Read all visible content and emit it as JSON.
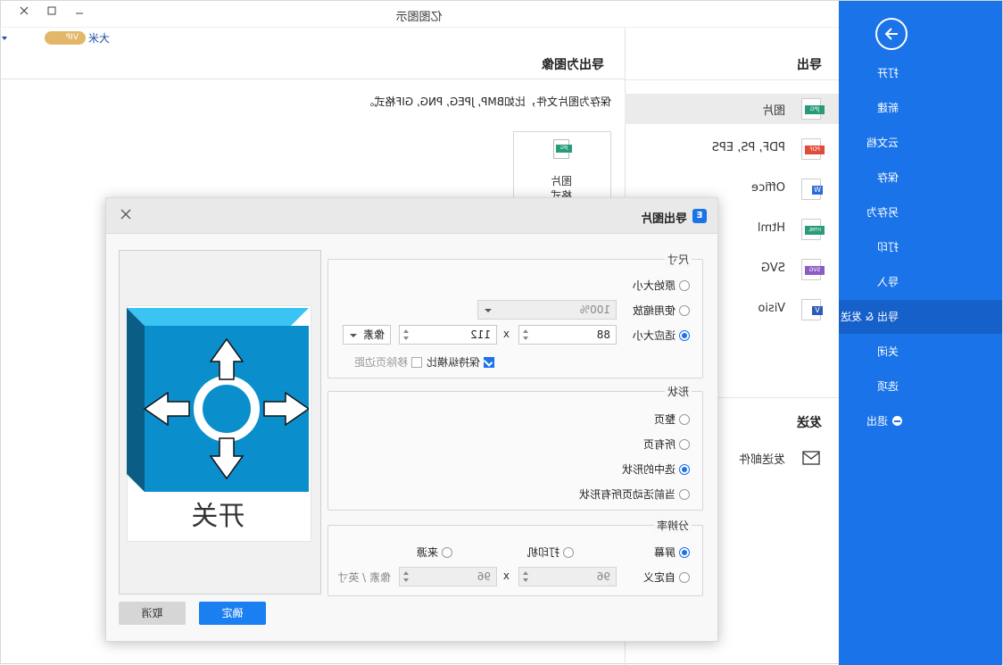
{
  "titlebar": {
    "title": "亿图图示"
  },
  "user": {
    "name": "大米",
    "badge": "VIP"
  },
  "sidebar": {
    "items": [
      {
        "label": "打开"
      },
      {
        "label": "新建"
      },
      {
        "label": "云文档"
      },
      {
        "label": "保存"
      },
      {
        "label": "另存为"
      },
      {
        "label": "打印"
      },
      {
        "label": "导入"
      },
      {
        "label": "导出 & 发送"
      },
      {
        "label": "关闭"
      },
      {
        "label": "选项"
      },
      {
        "label": "退出"
      }
    ],
    "active_index": 7,
    "accent": "#1a73e8"
  },
  "export_panel": {
    "header": "导出",
    "send_header": "发送",
    "formats": [
      {
        "label": "图片",
        "tag": "JPG",
        "color": "#2a9b7a"
      },
      {
        "label": "PDF, PS, EPS",
        "tag": "PDF",
        "color": "#e04b3a"
      },
      {
        "label": "Office",
        "tag": "W",
        "color": "#2b6bd6"
      },
      {
        "label": "Html",
        "tag": "HTML",
        "color": "#2a9b7a"
      },
      {
        "label": "SVG",
        "tag": "SVG",
        "color": "#8c5cc4"
      },
      {
        "label": "Visio",
        "tag": "V",
        "color": "#2b5bb8"
      }
    ],
    "send_items": [
      {
        "label": "发送邮件",
        "icon": "mail-icon"
      }
    ]
  },
  "main": {
    "title": "导出为图像",
    "description": "保存为图片文件，比如BMP, JPEG, PNG, GIF格式。",
    "card": {
      "label_line1": "图片",
      "label_line2": "格式",
      "tag": "JPG"
    }
  },
  "dialog": {
    "title": "导出图片",
    "size": {
      "legend": "尺寸",
      "original": "原始大小",
      "use_zoom": "使用缩放",
      "zoom_value": "100%",
      "fit_size": "适应大小",
      "width": "88",
      "x_sep": "x",
      "height": "112",
      "unit": "像素",
      "keep_ratio": "保持纵横比",
      "remove_margin": "移除页边距"
    },
    "shape": {
      "legend": "形状",
      "whole_page": "整页",
      "all_pages": "所有页",
      "selected_shape": "选中的形状",
      "active_page_shapes": "当前活动页所有形状"
    },
    "resolution": {
      "legend": "分辨率",
      "screen": "屏幕",
      "printer": "打印机",
      "source": "来源",
      "custom": "自定义",
      "dpi_x": "96",
      "x_sep": "x",
      "dpi_y": "96",
      "unit": "像素 / 英寸"
    },
    "preview": {
      "label": "开关",
      "accent": "#0a9ad8"
    },
    "ok": "确定",
    "cancel": "取消"
  }
}
